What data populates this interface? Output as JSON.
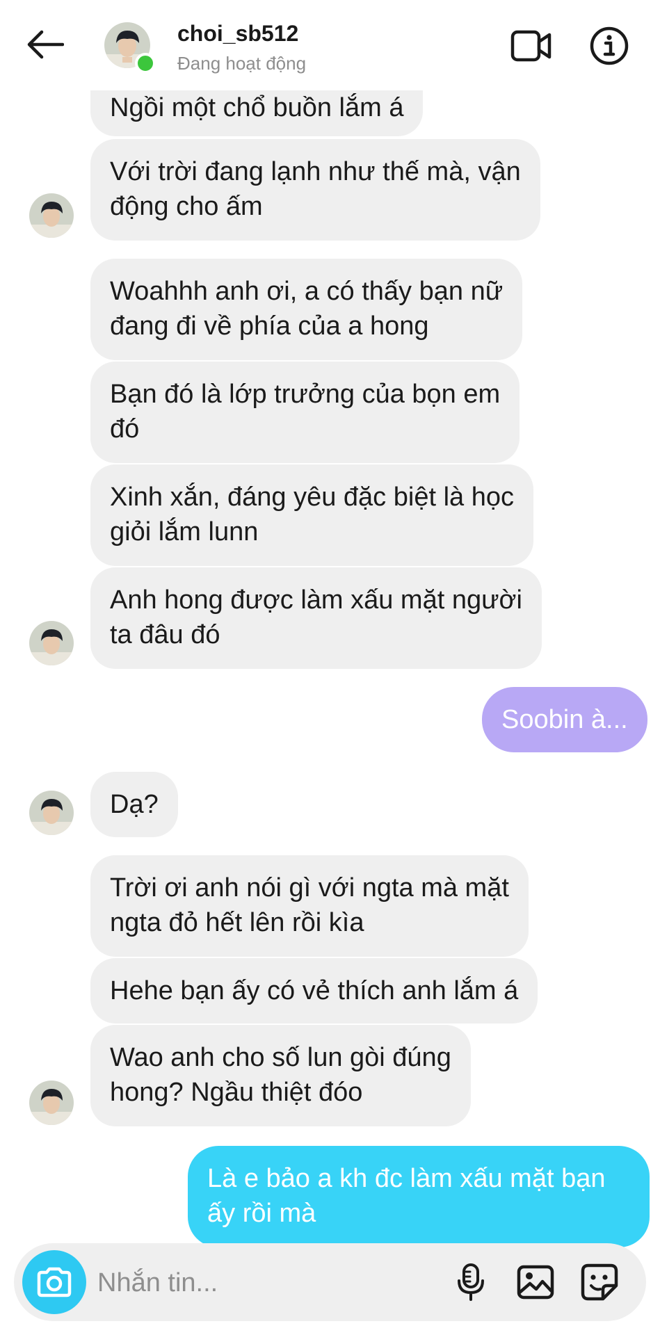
{
  "header": {
    "username": "choi_sb512",
    "status": "Đang hoạt động"
  },
  "messages": [
    {
      "text": "Ngồi một chổ buồn lắm á",
      "from": "them"
    },
    {
      "text": "Với trời đang lạnh như thế mà, vận\nđộng cho ấm",
      "from": "them"
    },
    {
      "text": "Woahhh anh ơi, a có thấy bạn nữ\nđang đi về phía của a hong",
      "from": "them"
    },
    {
      "text": "Bạn đó là lớp trưởng của bọn em\nđó",
      "from": "them"
    },
    {
      "text": "Xinh xắn, đáng yêu đặc biệt là học\ngiỏi lắm lunn",
      "from": "them"
    },
    {
      "text": "Anh hong được làm xấu mặt người\nta đâu đó",
      "from": "them"
    },
    {
      "text": "Soobin à...",
      "from": "me"
    },
    {
      "text": "Dạ?",
      "from": "them"
    },
    {
      "text": "Trời ơi anh nói gì với ngta mà mặt\nngta đỏ hết lên rồi kìa",
      "from": "them"
    },
    {
      "text": "Hehe bạn ấy có vẻ thích anh lắm á",
      "from": "them"
    },
    {
      "text": "Wao anh cho số lun gòi đúng\nhong? Ngầu thiệt đóo",
      "from": "them"
    },
    {
      "text": "Là e bảo a kh đc làm xấu mặt bạn\nấy rồi mà",
      "from": "me"
    }
  ],
  "composer": {
    "placeholder": "Nhắn tin..."
  },
  "colors": {
    "incoming_bubble": "#efefef",
    "outgoing_purple": "#b8a8f5",
    "outgoing_blue": "#38d3f7",
    "online": "#3cc63c",
    "camera_button": "#2ec9f2"
  }
}
